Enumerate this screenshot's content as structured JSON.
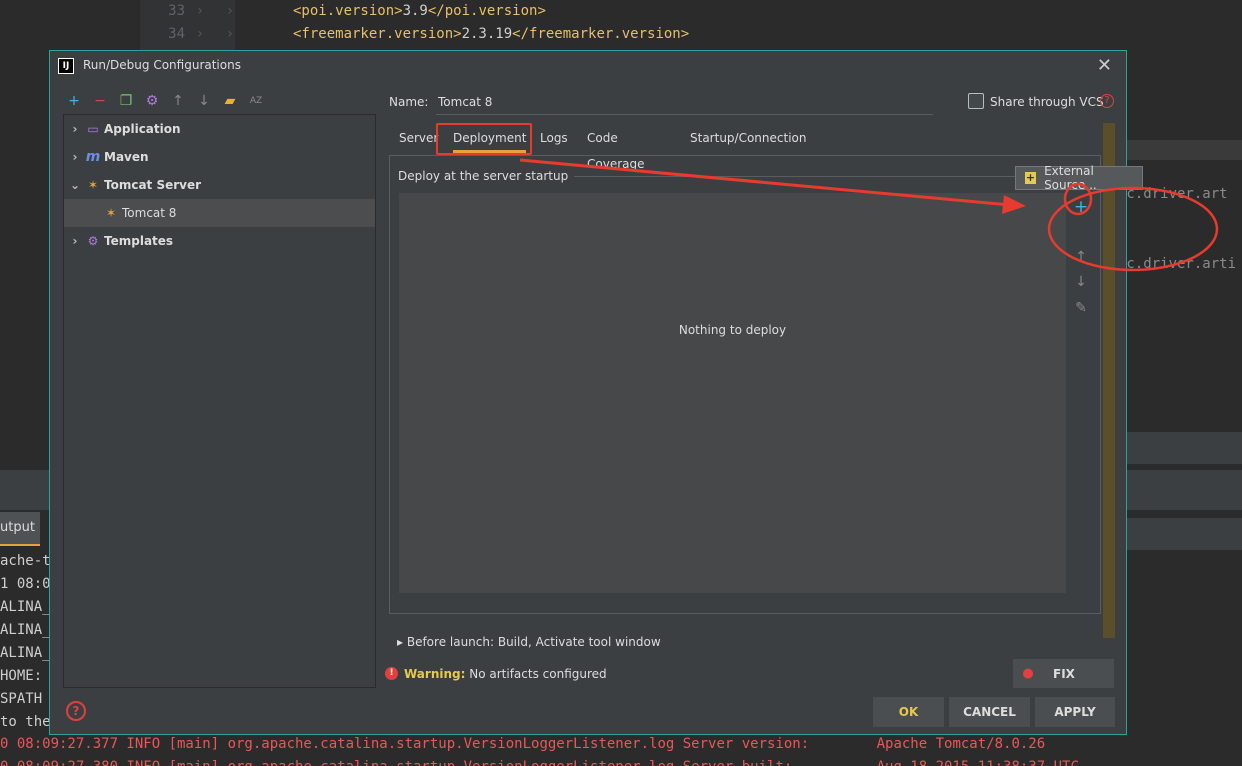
{
  "editor": {
    "lines": [
      {
        "number": "33",
        "tag_open": "<poi.version>",
        "value": "3.9",
        "tag_close": "</poi.version>"
      },
      {
        "number": "34",
        "tag_open": "<freemarker.version>",
        "value": "2.3.19",
        "tag_close": "</freemarker.version>"
      }
    ],
    "right_fragment_1": "pc.driver.art",
    "right_fragment_2": "ac.driver.arti"
  },
  "console": {
    "tab_label": "utput",
    "lines": [
      "ache-t",
      "1 08:0",
      "ALINA_B",
      "ALINA_H",
      "ALINA_T",
      "HOME:",
      "SPATH",
      "to the"
    ],
    "log_line_1": "0 08:09:27.377 INFO [main] org.apache.catalina.startup.VersionLoggerListener.log Server version:        Apache Tomcat/8.0.26",
    "log_line_2": "0 08:09:27.380 INFO [main] org.apache.catalina.startup.VersionLoggerListener.log Server built:          Aug 18 2015 11:38:37 UTC"
  },
  "dialog": {
    "app_logo": "IJ",
    "title": "Run/Debug Configurations",
    "close_glyph": "✕",
    "toolbar": [
      {
        "name": "add-icon",
        "glyph": "+",
        "color": "#3fb8e0"
      },
      {
        "name": "remove-icon",
        "glyph": "−",
        "color": "#e04050"
      },
      {
        "name": "copy-icon",
        "glyph": "❐",
        "color": "#7ac36a"
      },
      {
        "name": "settings-icon",
        "glyph": "⚙",
        "color": "#b07ae0"
      },
      {
        "name": "move-up-icon",
        "glyph": "↑",
        "color": "#888888"
      },
      {
        "name": "move-down-icon",
        "glyph": "↓",
        "color": "#888888"
      },
      {
        "name": "folder-icon",
        "glyph": "▰",
        "color": "#e6b422"
      },
      {
        "name": "sort-icon",
        "glyph": "AZ",
        "color": "#888888"
      }
    ],
    "tree": [
      {
        "label": "Application",
        "arrow": "›",
        "icon": "application-icon",
        "glyph": "▭",
        "color": "#b07ae0",
        "selected": false
      },
      {
        "label": "Maven",
        "arrow": "›",
        "icon": "maven-icon",
        "glyph": "m",
        "color": "#6b8ee6",
        "selected": false
      },
      {
        "label": "Tomcat Server",
        "arrow": "⌄",
        "icon": "tomcat-icon",
        "glyph": "✶",
        "color": "#e6a23c",
        "selected": false
      },
      {
        "label": "Tomcat 8",
        "arrow": "",
        "icon": "tomcat-icon",
        "glyph": "✶",
        "color": "#e6a23c",
        "selected": true
      },
      {
        "label": "Templates",
        "arrow": "›",
        "icon": "settings-icon",
        "glyph": "⚙",
        "color": "#b07ae0",
        "selected": false
      }
    ],
    "help_glyph": "?",
    "name_label": "Name:",
    "name_value": "Tomcat 8",
    "share_label": "Share through VCS",
    "share_checked": false,
    "tabs": [
      "Server",
      "Deployment",
      "Logs",
      "Code Coverage",
      "Startup/Connection"
    ],
    "active_tab": "Deployment",
    "section_title": "Deploy at the server startup",
    "empty_text": "Nothing to deploy",
    "side_tools": [
      {
        "name": "add-icon",
        "glyph": "+",
        "color": "#3fb8e0"
      },
      {
        "name": "move-up-icon",
        "glyph": "↑",
        "color": "#888888"
      },
      {
        "name": "move-down-icon",
        "glyph": "↓",
        "color": "#888888"
      },
      {
        "name": "edit-icon",
        "glyph": "✎",
        "color": "#888888"
      }
    ],
    "popup_item": "External Source...",
    "popup_glyph": "+",
    "before_launch": "▸  Before launch: Build, Activate tool window",
    "warning_icon_glyph": "!",
    "warning_prefix": "Warning:",
    "warning_text": "No artifacts configured",
    "fix_glyph": "●",
    "fix_label": "FIX",
    "ok_label": "OK",
    "cancel_label": "CANCEL",
    "apply_label": "APPLY"
  },
  "colors": {
    "accent": "#e6a23c",
    "annotation": "#e63b2e",
    "dialog_border": "#2ba39a",
    "warning": "#e6c94e"
  }
}
